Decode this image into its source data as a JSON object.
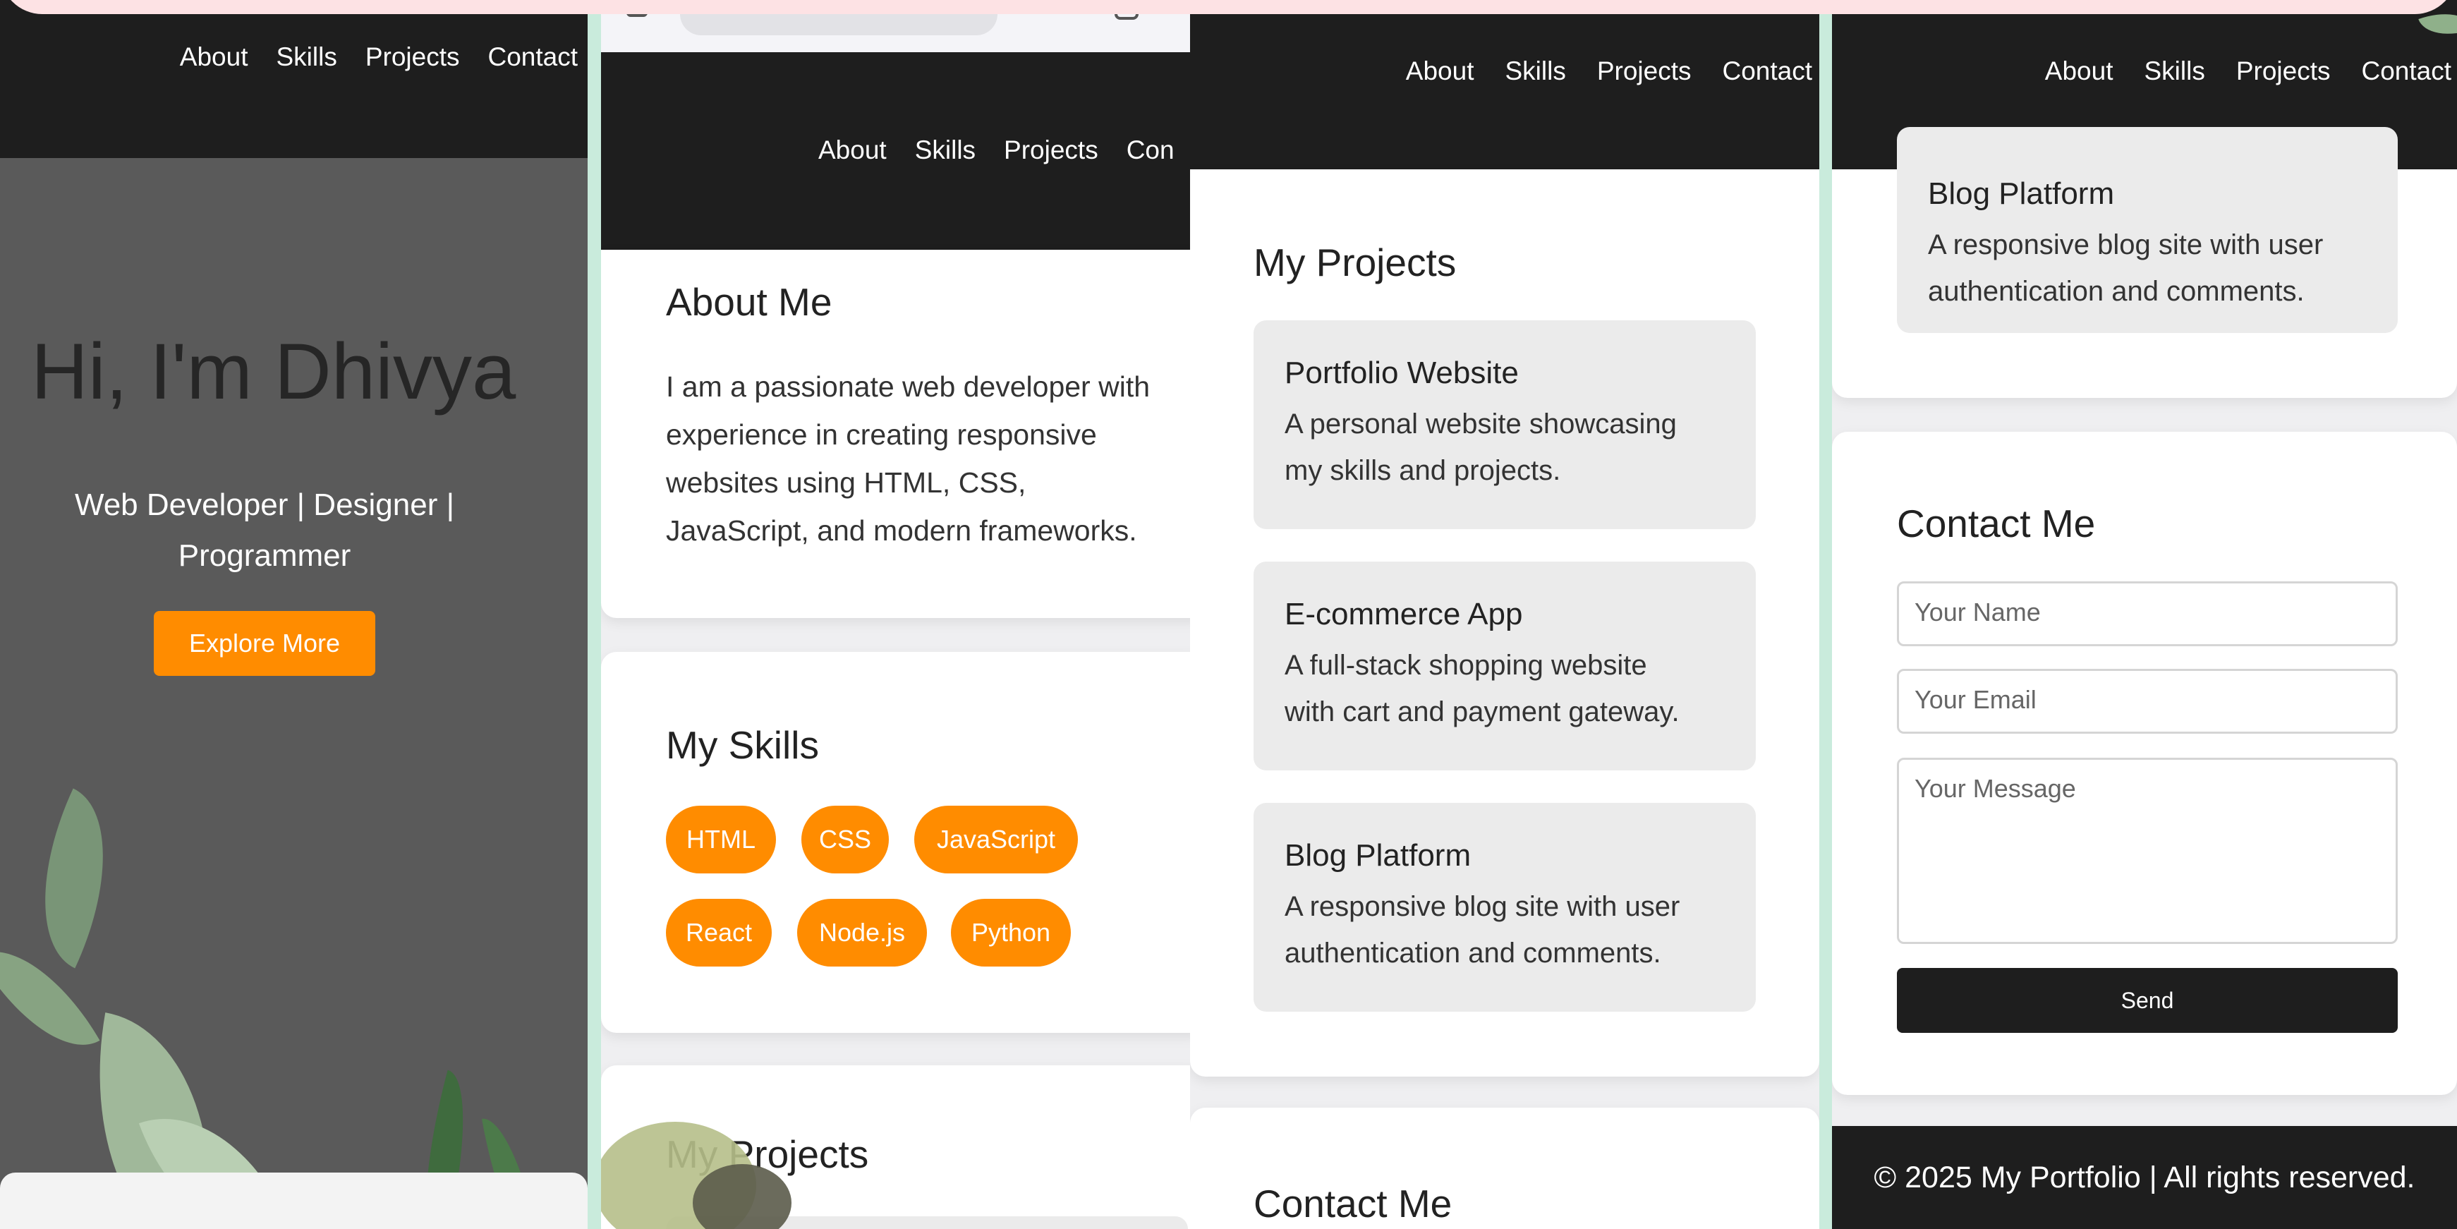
{
  "nav": {
    "about": "About",
    "skills": "Skills",
    "projects": "Projects",
    "contact": "Contact"
  },
  "nav_clipped": {
    "contact": "Con"
  },
  "hero": {
    "title": "Hi, I'm Dhivya",
    "subtitle_line1": "Web Developer | Designer |",
    "subtitle_line2": "Programmer",
    "cta": "Explore More"
  },
  "about": {
    "title": "About Me",
    "lines": [
      "I am a passionate web developer with",
      "experience in creating responsive",
      "websites using HTML, CSS,",
      "JavaScript, and modern frameworks."
    ]
  },
  "skills": {
    "title": "My Skills",
    "items": [
      "HTML",
      "CSS",
      "JavaScript",
      "React",
      "Node.js",
      "Python"
    ]
  },
  "projects": {
    "title": "My Projects",
    "title_partial": "My Projects",
    "items": [
      {
        "title": "Portfolio Website",
        "line1": "A personal website showcasing",
        "line2": "my skills and projects."
      },
      {
        "title": "E-commerce App",
        "line1": "A full-stack shopping website",
        "line2": "with cart and payment gateway."
      },
      {
        "title": "Blog Platform",
        "line1": "A responsive blog site with user",
        "line2": "authentication and comments."
      }
    ]
  },
  "contact": {
    "title": "Contact Me",
    "name_placeholder": "Your Name",
    "email_placeholder": "Your Email",
    "message_placeholder": "Your Message",
    "send": "Send"
  },
  "footer": {
    "text": "© 2025 My Portfolio | All rights reserved."
  },
  "colors": {
    "accent": "#ff8c00",
    "dark": "#1e1e1e",
    "card_bg": "#ebebeb",
    "hero_bg": "#5a5a5a"
  }
}
